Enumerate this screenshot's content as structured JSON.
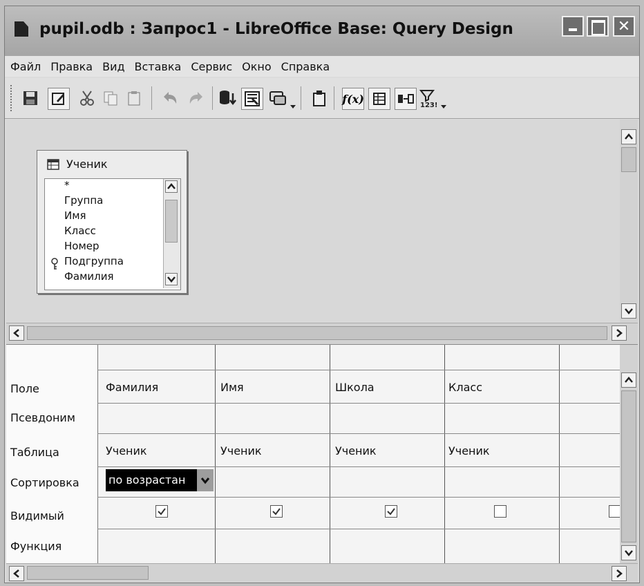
{
  "window": {
    "title": "pupil.odb : Запрос1 - LibreOffice Base: Query Design"
  },
  "menu": [
    "Файл",
    "Правка",
    "Вид",
    "Вставка",
    "Сервис",
    "Окно",
    "Справка"
  ],
  "table_window": {
    "title": "Ученик",
    "fields": [
      "*",
      "Группа",
      "Имя",
      "Класс",
      "Номер",
      "Подгруппа",
      "Фамилия"
    ]
  },
  "grid": {
    "row_labels": [
      "Поле",
      "Псевдоним",
      "Таблица",
      "Сортировка",
      "Видимый",
      "Функция"
    ],
    "columns": [
      {
        "field": "Фамилия",
        "table": "Ученик",
        "sort": "по возрастан",
        "visible": true
      },
      {
        "field": "Имя",
        "table": "Ученик",
        "sort": "",
        "visible": true
      },
      {
        "field": "Школа",
        "table": "Ученик",
        "sort": "",
        "visible": true
      },
      {
        "field": "Класс",
        "table": "Ученик",
        "sort": "",
        "visible": false
      },
      {
        "field": "",
        "table": "",
        "sort": "",
        "visible": false
      }
    ]
  },
  "icons": {
    "toolbar": [
      "save-icon",
      "edit-icon",
      "cut-icon",
      "copy-icon",
      "paste-icon",
      "undo-icon",
      "redo-icon",
      "run-query-icon",
      "clear-query-icon",
      "design-view-icon",
      "add-tables-icon",
      "functions-icon",
      "table-name-icon",
      "alias-icon",
      "distinct-values-icon"
    ]
  },
  "colors": {
    "selected_cell_bg": "#000000",
    "title_bar": "#b0b0b0"
  }
}
